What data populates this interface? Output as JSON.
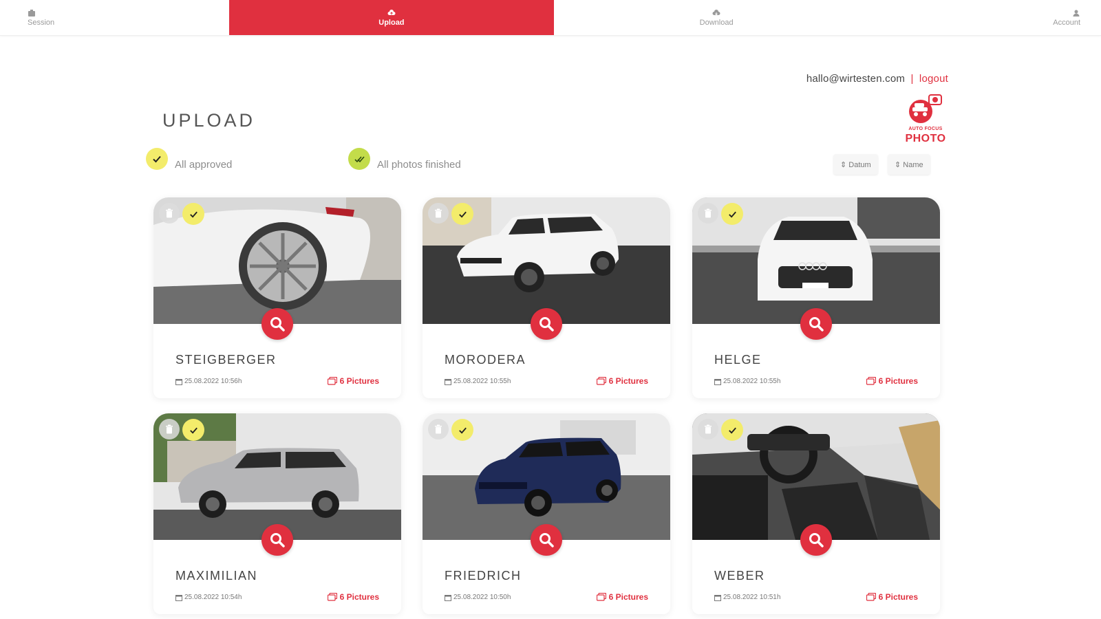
{
  "nav": {
    "tabs": [
      {
        "label": "Session",
        "icon": "session-icon"
      },
      {
        "label": "Upload",
        "icon": "cloud-upload-icon",
        "active": true
      },
      {
        "label": "Download",
        "icon": "cloud-download-icon"
      },
      {
        "label": "Account",
        "icon": "user-icon"
      }
    ]
  },
  "account": {
    "email": "hallo@wirtesten.com",
    "separator": "|",
    "logout": "logout"
  },
  "logo": {
    "small": "AUTO FOCUS",
    "big": "PHOTO"
  },
  "page": {
    "title": "UPLOAD"
  },
  "status": {
    "approved": "All approved",
    "finished": "All photos finished"
  },
  "sort": {
    "date": "⇕ Datum",
    "name": "⇕ Name"
  },
  "colors": {
    "accent": "#e0303f",
    "approved_badge": "#f3ec6b",
    "finished_badge": "#c3dc4a"
  },
  "cards": [
    {
      "name": "STEIGBERGER",
      "date": "25.08.2022 10:56h",
      "pictures": "6 Pictures",
      "photo": "white coupe rear wheel"
    },
    {
      "name": "MORODERA",
      "date": "25.08.2022 10:55h",
      "pictures": "6 Pictures",
      "photo": "white suv"
    },
    {
      "name": "HELGE",
      "date": "25.08.2022 10:55h",
      "pictures": "6 Pictures",
      "photo": "white hatchback front"
    },
    {
      "name": "MAXIMILIAN",
      "date": "25.08.2022 10:54h",
      "pictures": "6 Pictures",
      "photo": "silver suv"
    },
    {
      "name": "FRIEDRICH",
      "date": "25.08.2022 10:50h",
      "pictures": "6 Pictures",
      "photo": "dark blue suv"
    },
    {
      "name": "WEBER",
      "date": "25.08.2022 10:51h",
      "pictures": "6 Pictures",
      "photo": "car interior"
    }
  ]
}
